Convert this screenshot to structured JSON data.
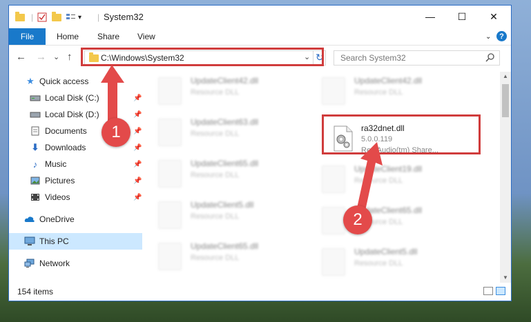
{
  "window": {
    "title": "System32",
    "controls": {
      "minimize": "—",
      "maximize": "☐",
      "close": "✕"
    }
  },
  "ribbon": {
    "tabs": [
      "File",
      "Home",
      "Share",
      "View"
    ],
    "help": "?"
  },
  "navigation": {
    "back": "←",
    "forward": "→",
    "dropdown": "⌄",
    "up": "↑",
    "address": "C:\\Windows\\System32",
    "refresh": "↻",
    "search_placeholder": "Search System32"
  },
  "sidebar": {
    "items": [
      {
        "label": "Quick access",
        "icon": "star-icon",
        "pinned": false
      },
      {
        "label": "Local Disk (C:)",
        "icon": "drive-icon",
        "pinned": true
      },
      {
        "label": "Local Disk (D:)",
        "icon": "drive-icon",
        "pinned": true
      },
      {
        "label": "Documents",
        "icon": "documents-icon",
        "pinned": true
      },
      {
        "label": "Downloads",
        "icon": "download-icon",
        "pinned": true
      },
      {
        "label": "Music",
        "icon": "music-icon",
        "pinned": true
      },
      {
        "label": "Pictures",
        "icon": "pictures-icon",
        "pinned": true
      },
      {
        "label": "Videos",
        "icon": "videos-icon",
        "pinned": true
      },
      {
        "label": "OneDrive",
        "icon": "cloud-icon",
        "pinned": false
      },
      {
        "label": "This PC",
        "icon": "pc-icon",
        "pinned": false,
        "selected": true
      },
      {
        "label": "Network",
        "icon": "network-icon",
        "pinned": false
      }
    ]
  },
  "files": {
    "left": [
      {
        "name": "UpdateClient42.dll",
        "desc": "Resource DLL"
      },
      {
        "name": "UpdateClient63.dll",
        "desc": "Resource DLL"
      },
      {
        "name": "UpdateClient65.dll",
        "desc": "Resource DLL"
      },
      {
        "name": "UpdateClient5.dll",
        "desc": "Resource DLL"
      },
      {
        "name": "UpdateClient65.dll",
        "desc": "Resource DLL"
      }
    ],
    "right": [
      {
        "name": "UpdateClient42.dll",
        "desc": "Resource DLL"
      },
      {
        "name": "ra32dnet.dll",
        "version": "5.0.0.119",
        "desc": "RealAudio(tm) Share..."
      },
      {
        "name": "UpdateClient19.dll",
        "desc": "Resource DLL"
      },
      {
        "name": "UpdateClient65.dll",
        "desc": "Resource DLL"
      },
      {
        "name": "UpdateClient5.dll",
        "desc": "Resource DLL"
      }
    ]
  },
  "status": {
    "items_count": "154 items"
  },
  "annotations": {
    "step1": "1",
    "step2": "2",
    "highlight_color": "#d03c3c",
    "badge_color": "#e34a4a"
  }
}
